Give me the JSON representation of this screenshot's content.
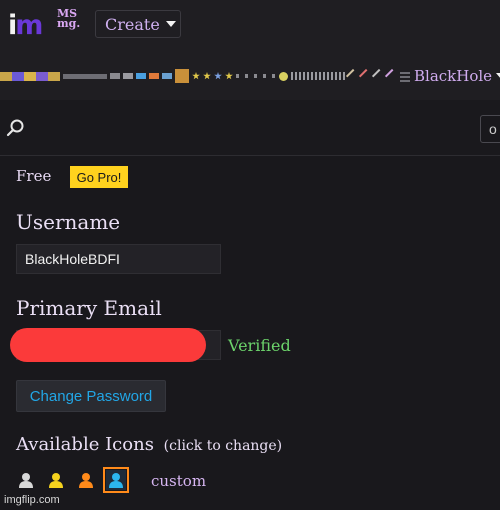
{
  "header": {
    "logo_i": "i",
    "logo_m": "m",
    "ms_logo": "MS mg.",
    "create_label": "Create",
    "user_menu_label": "BlackHole"
  },
  "search": {
    "input_value": "o"
  },
  "account": {
    "plan_label": "Free",
    "go_pro_label": "Go Pro!",
    "username_label": "Username",
    "username_value": "BlackHoleBDFI",
    "email_label": "Primary Email",
    "verified_label": "Verified",
    "change_password_label": "Change Password",
    "icons_label": "Available Icons",
    "icons_hint": "(click to change)",
    "custom_label": "custom",
    "icon_colors": [
      "#d8d8d8",
      "#f5d21e",
      "#ff8a1a",
      "#2cb6ef"
    ]
  },
  "watermark": "imgflip.com",
  "colors": {
    "brand_purple": "#6a38d8",
    "gopro_yellow": "#ffd21e",
    "verified_green": "#6cd36b",
    "link_blue": "#22a6e6",
    "redaction_red": "#fb3a3a"
  }
}
